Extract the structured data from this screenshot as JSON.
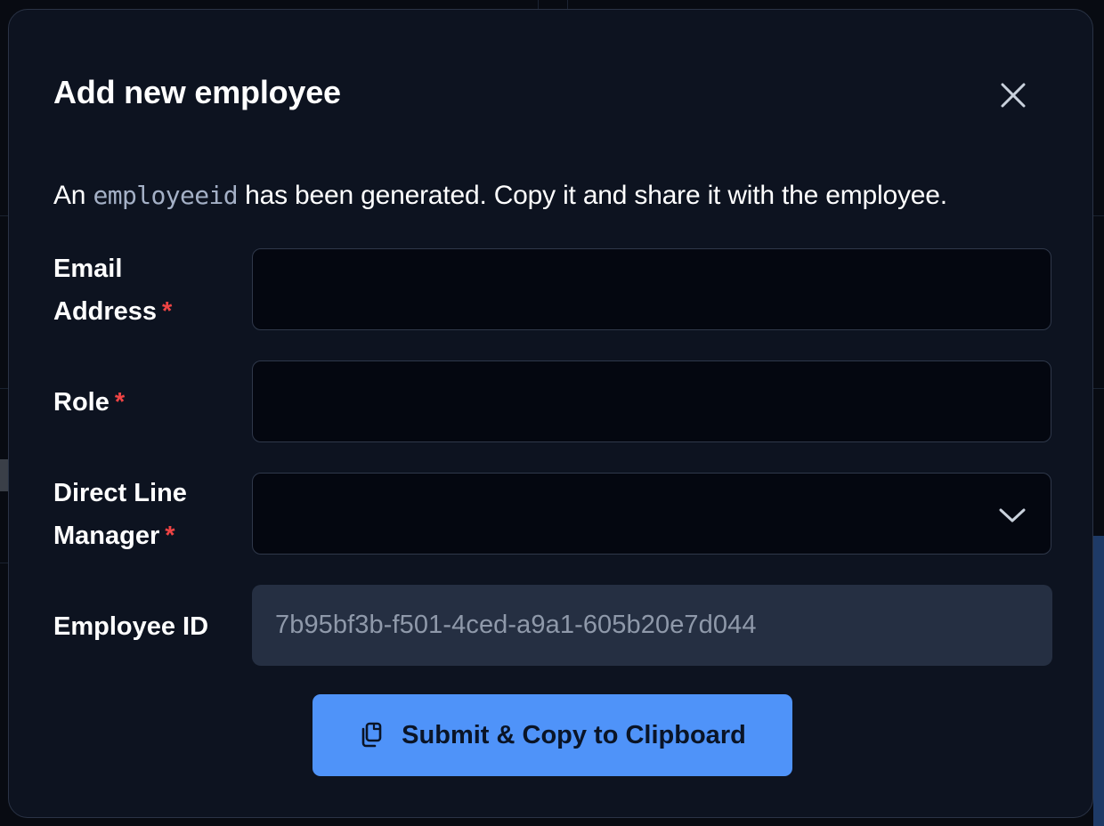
{
  "modal": {
    "title": "Add new employee",
    "description_prefix": "An ",
    "description_code": "employeeid",
    "description_suffix": " has been generated. Copy it and share it with the employee."
  },
  "form": {
    "email": {
      "label_line1": "Email",
      "label_line2": "Address",
      "required_mark": "*",
      "value": ""
    },
    "role": {
      "label": "Role",
      "required_mark": "*",
      "value": ""
    },
    "manager": {
      "label_line1": "Direct Line",
      "label_line2": "Manager",
      "required_mark": "*",
      "selected_value": ""
    },
    "employee_id": {
      "label": "Employee ID",
      "value": "7b95bf3b-f501-4ced-a9a1-605b20e7d044"
    }
  },
  "actions": {
    "submit_label": "Submit & Copy to Clipboard",
    "submit_icon": "copy-icon",
    "close_icon": "close-icon"
  },
  "colors": {
    "modal_bg": "#0d1320",
    "primary": "#4f93f9",
    "required": "#ef4444",
    "input_bg": "#040710",
    "readonly_bg": "#252f42"
  }
}
